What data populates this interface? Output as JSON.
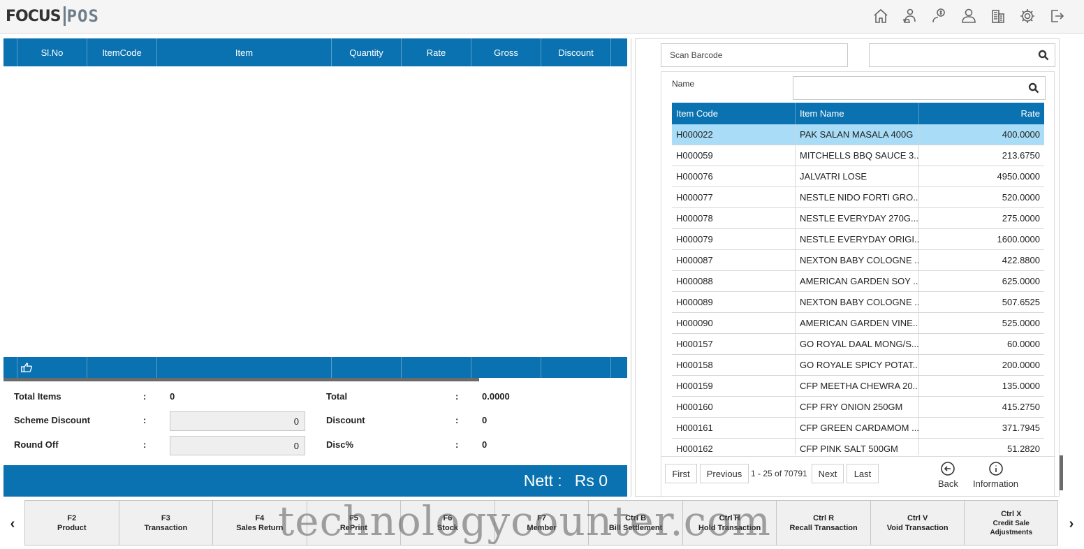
{
  "logo": {
    "left": "FOCUS",
    "right": "POS"
  },
  "top_icons": [
    "home-icon",
    "user-cart-icon",
    "user-money-icon",
    "user-icon",
    "building-icon",
    "gear-icon",
    "exit-icon"
  ],
  "grid": {
    "columns": [
      "Sl.No",
      "ItemCode",
      "Item",
      "Quantity",
      "Rate",
      "Gross",
      "Discount"
    ]
  },
  "totals": {
    "total_items_label": "Total Items",
    "total_items_value": "0",
    "scheme_discount_label": "Scheme Discount",
    "scheme_discount_value": "0",
    "round_off_label": "Round Off",
    "round_off_value": "0",
    "total_label": "Total",
    "total_value": "0.0000",
    "discount_label": "Discount",
    "discount_value": "0",
    "disc_pct_label": "Disc%",
    "disc_pct_value": "0",
    "colon": ":"
  },
  "nett": {
    "label": "Nett :",
    "value": "Rs 0"
  },
  "search": {
    "scan_barcode": "Scan Barcode",
    "name_label": "Name"
  },
  "item_table": {
    "headers": [
      "Item Code",
      "Item Name",
      "Rate"
    ],
    "rows": [
      [
        "H000022",
        "PAK SALAN MASALA 400G",
        "400.0000"
      ],
      [
        "H000059",
        "MITCHELLS BBQ SAUCE 3...",
        "213.6750"
      ],
      [
        "H000076",
        "JALVATRI LOSE",
        "4950.0000"
      ],
      [
        "H000077",
        "NESTLE NIDO FORTI GRO...",
        "520.0000"
      ],
      [
        "H000078",
        "NESTLE EVERYDAY 270G...",
        "275.0000"
      ],
      [
        "H000079",
        "NESTLE EVERYDAY ORIGI...",
        "1600.0000"
      ],
      [
        "H000087",
        "NEXTON BABY COLOGNE ...",
        "422.8800"
      ],
      [
        "H000088",
        "AMERICAN GARDEN SOY ...",
        "625.0000"
      ],
      [
        "H000089",
        "NEXTON BABY COLOGNE ...",
        "507.6525"
      ],
      [
        "H000090",
        "AMERICAN GARDEN VINE...",
        "525.0000"
      ],
      [
        "H000157",
        "GO ROYAL DAAL MONG/S...",
        "60.0000"
      ],
      [
        "H000158",
        "GO ROYALE SPICY POTAT...",
        "200.0000"
      ],
      [
        "H000159",
        "CFP MEETHA CHEWRA 20...",
        "135.0000"
      ],
      [
        "H000160",
        "CFP FRY ONION 250GM",
        "415.2750"
      ],
      [
        "H000161",
        "CFP GREEN CARDAMOM ...",
        "371.7945"
      ],
      [
        "H000162",
        "CFP PINK SALT 500GM",
        "51.2820"
      ]
    ]
  },
  "pager": {
    "first": "First",
    "previous": "Previous",
    "info": "1 - 25 of 70791",
    "next": "Next",
    "last": "Last",
    "back": "Back",
    "information": "Information"
  },
  "fkeys": [
    {
      "key": "F2",
      "label": "Product"
    },
    {
      "key": "F3",
      "label": "Transaction"
    },
    {
      "key": "F4",
      "label": "Sales Return"
    },
    {
      "key": "F5",
      "label": "RePrint"
    },
    {
      "key": "F6",
      "label": "Stock"
    },
    {
      "key": "F7",
      "label": "Member"
    },
    {
      "key": "Ctrl B",
      "label": "Bill Settlement"
    },
    {
      "key": "Ctrl H",
      "label": "Hold Transaction"
    },
    {
      "key": "Ctrl R",
      "label": "Recall Transaction"
    },
    {
      "key": "Ctrl V",
      "label": "Void Transaction"
    },
    {
      "key": "Ctrl X",
      "label": "Credit Sale\nAdjustments"
    }
  ],
  "nav": {
    "prev": "‹",
    "next": "›"
  },
  "watermark": "technologycounter.com",
  "colors": {
    "primary": "#0a72b0",
    "selected_row": "#a8dcf7"
  }
}
